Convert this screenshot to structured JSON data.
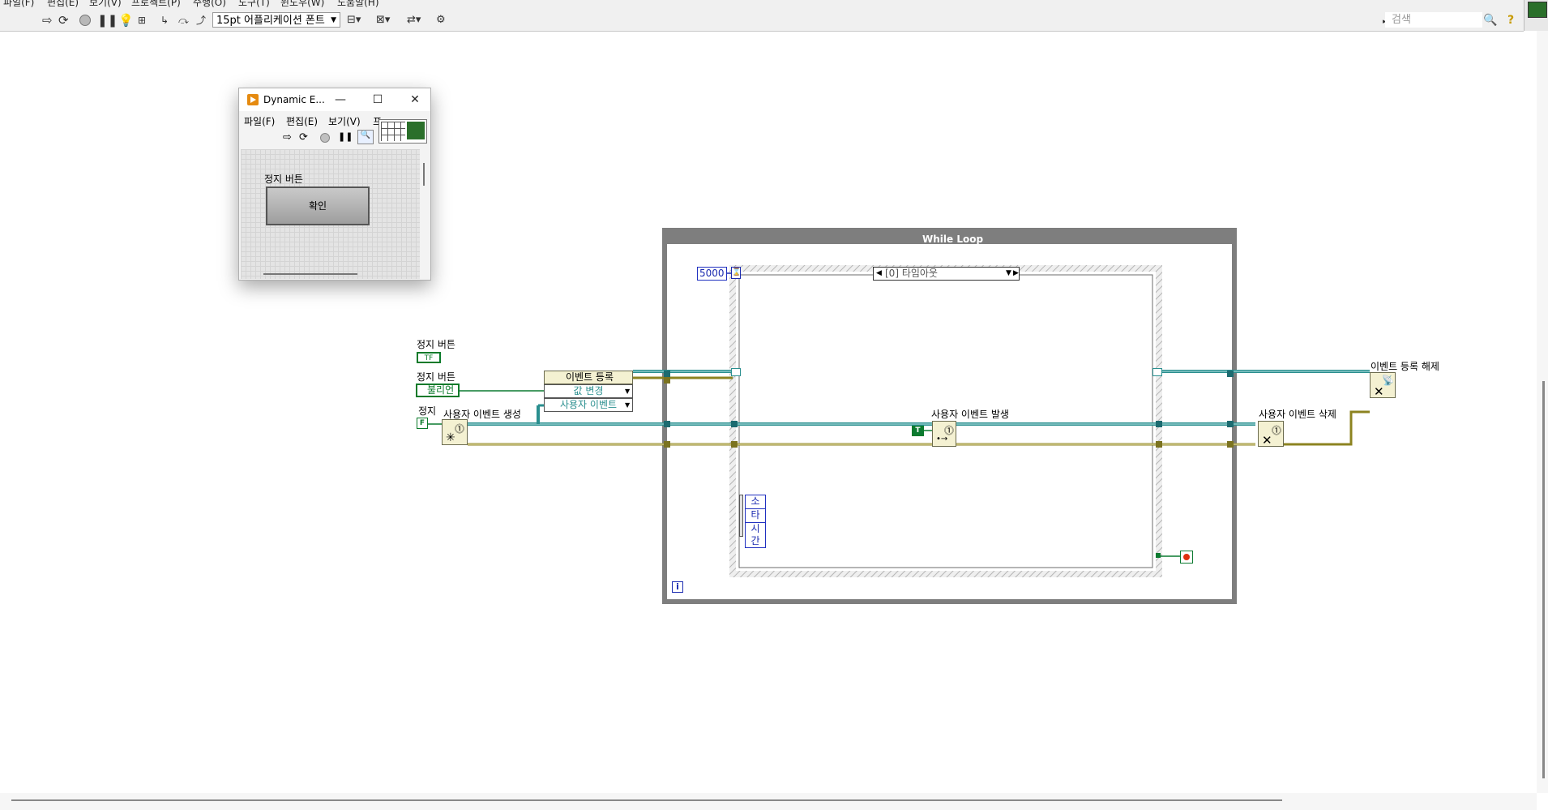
{
  "menu": [
    "파일(F)",
    "편집(E)",
    "보기(V)",
    "프로젝트(P)",
    "수행(O)",
    "도구(T)",
    "윈도우(W)",
    "도움말(H)"
  ],
  "toolbar": {
    "font_select": "15pt 어플리케이션 폰트",
    "search_placeholder": "검색",
    "icons": [
      "run-arrow-icon",
      "run-continuously-icon",
      "abort-icon",
      "pause-icon",
      "highlight-execution-icon",
      "retain-wire-values-icon",
      "step-into-icon",
      "step-over-icon",
      "step-out-icon",
      "align-icon",
      "distribute-icon",
      "reorder-icon",
      "cleanup-icon",
      "search-icon",
      "help-icon"
    ]
  },
  "front_panel": {
    "title": "Dynamic E...",
    "menu": [
      "파일(F)",
      "편집(E)",
      "보기(V)",
      "프"
    ],
    "control_label": "정지 버튼",
    "button_text": "확인"
  },
  "diagram": {
    "while_loop_label": "While Loop",
    "timeout_constant": "5000",
    "case_selector": "[0] 타임아웃",
    "event_data": [
      "소스",
      "타입",
      "시간"
    ],
    "stop_button_terminal_label": "정지 버튼",
    "stop_button_terminal_text": "TF",
    "boolean_label": "정지 버튼",
    "boolean_text": "불리언",
    "stop_label": "정지",
    "stop_const": "F",
    "create_user_event_label": "사용자 이벤트 생성",
    "register_events_label": "이벤트 등록",
    "register_item_1": "값 변경",
    "register_item_2": "사용자 이벤트",
    "generate_user_event_label": "사용자 이벤트 발생",
    "true_const": "T",
    "destroy_user_event_label": "사용자 이벤트 삭제",
    "unregister_events_label": "이벤트 등록 해제",
    "iteration_terminal": "i"
  },
  "colors": {
    "while_loop": "#7e7e7e",
    "refnum_wire": "#2a8f8f",
    "error_wire": "#8c8320",
    "boolean_wire": "#0c7a30",
    "numeric": "#1a2ab0"
  }
}
